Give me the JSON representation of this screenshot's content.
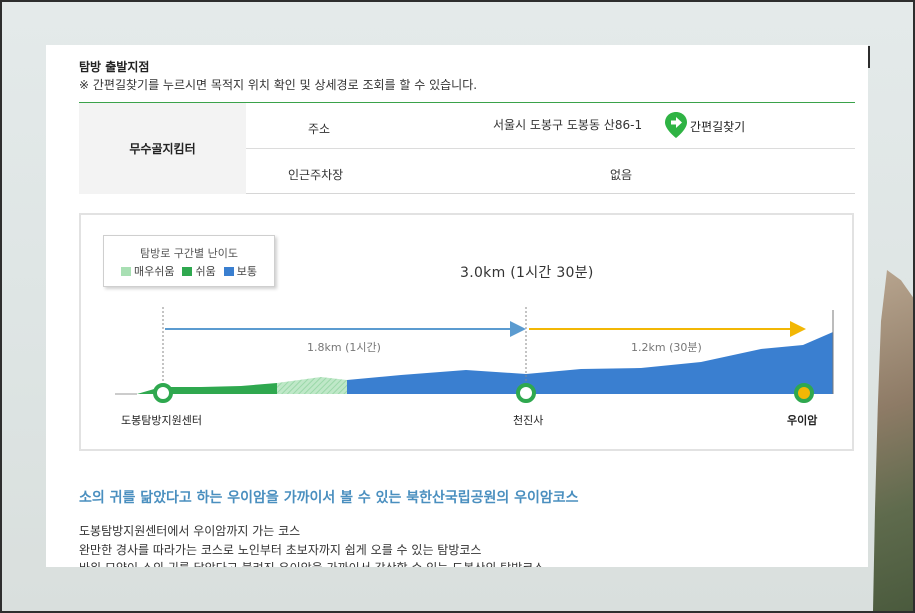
{
  "header": {
    "title": "탐방 출발지점",
    "note": "※ 간편길찾기를 누르시면 목적지 위치 확인 및 상세경로 조회를 할 수 있습니다."
  },
  "start_point": {
    "name": "무수골지킴터",
    "address_label": "주소",
    "address_value": "서울시 도봉구 도봉동 산86-1",
    "find_route_label": "간편길찾기",
    "parking_label": "인근주차장",
    "parking_value": "없음"
  },
  "legend": {
    "title": "탐방로 구간별 난이도",
    "items": [
      {
        "label": "매우쉬움",
        "color": "#a8dfb3"
      },
      {
        "label": "쉬움",
        "color": "#2fa84f"
      },
      {
        "label": "보통",
        "color": "#3a7fd0"
      }
    ]
  },
  "route": {
    "total": "3.0km (1시간 30분)",
    "segments": [
      {
        "label": "1.8km (1시간)",
        "color": "#5b9bd0"
      },
      {
        "label": "1.2km (30분)",
        "color": "#f2b705"
      }
    ],
    "points": [
      {
        "name": "도봉탐방지원센터",
        "bold": false
      },
      {
        "name": "천진사",
        "bold": false
      },
      {
        "name": "우이암",
        "bold": true
      }
    ]
  },
  "description": {
    "title": "소의 귀를 닮았다고 하는 우이암을 가까이서 볼 수 있는 북한산국립공원의 우이암코스",
    "lines": [
      "도봉탐방지원센터에서 우이암까지 가는 코스",
      "완만한 경사를 따라가는 코스로 노인부터 초보자까지 쉽게 오를 수 있는 탐방코스",
      "바위 모양이 소의 귀를 닮았다고 불려진 우이암을 가까이서 감상할 수 있는 도봉산의 탐방코스"
    ]
  }
}
